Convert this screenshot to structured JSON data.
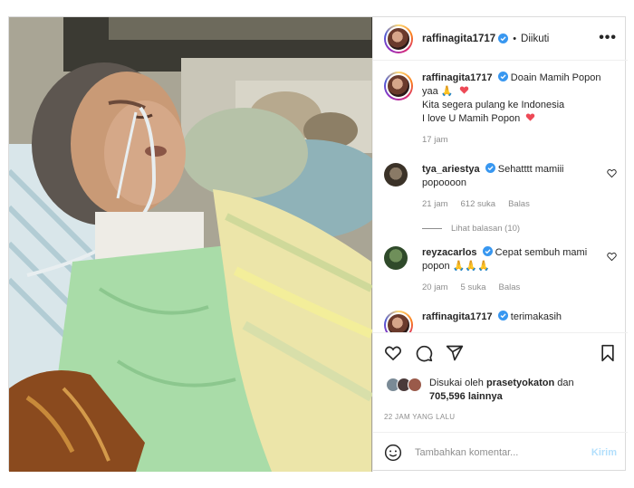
{
  "header": {
    "username": "raffinagita1717",
    "follow_state": "Diikuti",
    "more_label": "•••"
  },
  "caption": {
    "username": "raffinagita1717",
    "text_line1": "Doain Mamih Popon yaa 🙏",
    "text_line2": "Kita segera pulang ke Indonesia",
    "text_line3": "I love U Mamih Popon",
    "time": "17 jam"
  },
  "comments": [
    {
      "username": "tya_ariestya",
      "text": "Sehatttt mamiii popoooon",
      "time": "21 jam",
      "likes": "612 suka",
      "reply": "Balas"
    },
    {
      "username": "reyzacarlos",
      "text": "Cepat sembuh mami popon 🙏🙏🙏",
      "time": "20 jam",
      "likes": "5 suka",
      "reply": "Balas"
    },
    {
      "username": "raffinagita1717",
      "text": "terimakasih"
    }
  ],
  "view_replies": "Lihat balasan (10)",
  "likes": {
    "prefix": "Disukai oleh",
    "user": "prasetyokaton",
    "mid": "dan",
    "count": "705,596",
    "suffix": "lainnya"
  },
  "posted_ago": "22 JAM YANG LALU",
  "comment_input": {
    "placeholder": "Tambahkan komentar...",
    "post_label": "Kirim"
  },
  "colors": {
    "heart": "#ed4956",
    "verified": "#3897f0",
    "muted": "#8e8e8e",
    "post_button": "#b2dffc"
  }
}
